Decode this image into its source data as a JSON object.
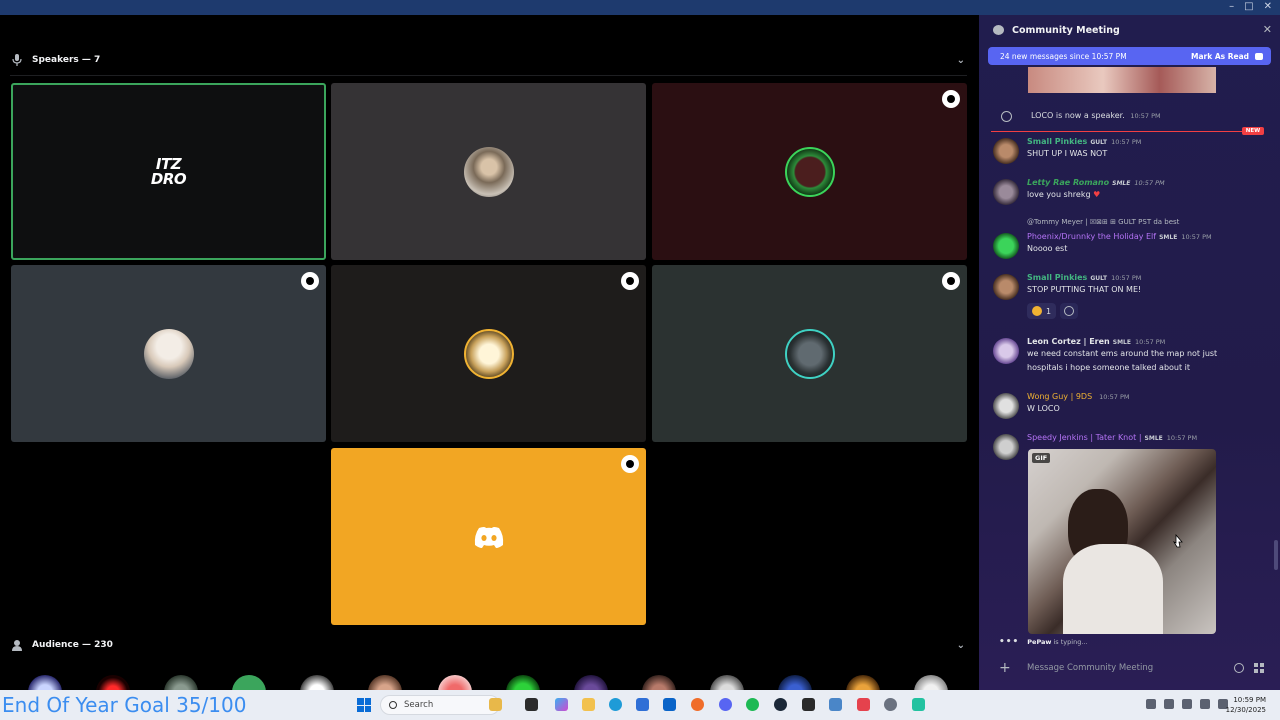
{
  "window": {
    "controls": [
      "–",
      "□",
      "✕"
    ]
  },
  "stage": {
    "speakers_label": "Speakers — 7",
    "audience_label": "Audience — 230",
    "tiles": [
      {
        "name": "ITZ DRO",
        "logo_line1": "ITZ",
        "logo_line2": "DRO",
        "speaking": true
      },
      {
        "name": "speaker-2"
      },
      {
        "name": "speaker-3"
      },
      {
        "name": "speaker-4"
      },
      {
        "name": "speaker-5"
      },
      {
        "name": "speaker-6"
      },
      {
        "name": "speaker-7"
      }
    ]
  },
  "chat": {
    "title": "Community Meeting",
    "banner_text": "24 new messages since 10:57 PM",
    "mark_as_read": "Mark As Read",
    "system_message": {
      "user": "LOCO",
      "text": "is now a speaker.",
      "time": "10:57 PM"
    },
    "new_label": "NEW",
    "messages": [
      {
        "user": "Small Pinkies",
        "tag": "GULT",
        "time": "10:57 PM",
        "text": "SHUT UP I WAS NOT",
        "color": "#43b581"
      },
      {
        "user": "Letty Rae Romano",
        "tag": "SMLE",
        "time": "10:57 PM",
        "text": "love you shrekg",
        "color": "#3ba55c"
      },
      {
        "user": "Phoenix/Drunnky the Holiday Elf",
        "tag": "SMLE",
        "time": "10:57 PM",
        "text": "Noooo est",
        "color": "#b473f5",
        "reply": "@Tommy Meyer | ☒⊠⊞ ⊞ GULT PST da best"
      },
      {
        "user": "Small Pinkies",
        "tag": "GULT",
        "time": "10:57 PM",
        "text": "STOP PUTTING THAT ON ME!",
        "color": "#43b581"
      },
      {
        "user": "Leon Cortez | Eren",
        "tag": "SMLE",
        "time": "10:57 PM",
        "text": "we need constant ems around the map not just",
        "text2": "hospitals i hope someone talked about it",
        "color": "#dbdee1"
      },
      {
        "user": "Wong Guy | 9DS",
        "tag": "",
        "time": "10:57 PM",
        "text": "W LOCO",
        "color": "#f0b232"
      },
      {
        "user": "Speedy Jenkins | Tater Knot |",
        "tag": "SMLE",
        "time": "10:57 PM",
        "text": "",
        "color": "#b473f5"
      }
    ],
    "reaction_count": "1",
    "gif_label": "GIF",
    "typing_user": "PePaw",
    "typing_text": "is typing...",
    "composer_placeholder": "Message Community Meeting"
  },
  "taskbar": {
    "goal_text": "End Of Year Goal 35/100",
    "search_placeholder": "Search",
    "time": "10:59 PM",
    "date": "12/30/2025"
  },
  "colors": {
    "speaking": "#3ba55c",
    "blurple": "#5865f2",
    "discord_tile": "#f2a623"
  }
}
